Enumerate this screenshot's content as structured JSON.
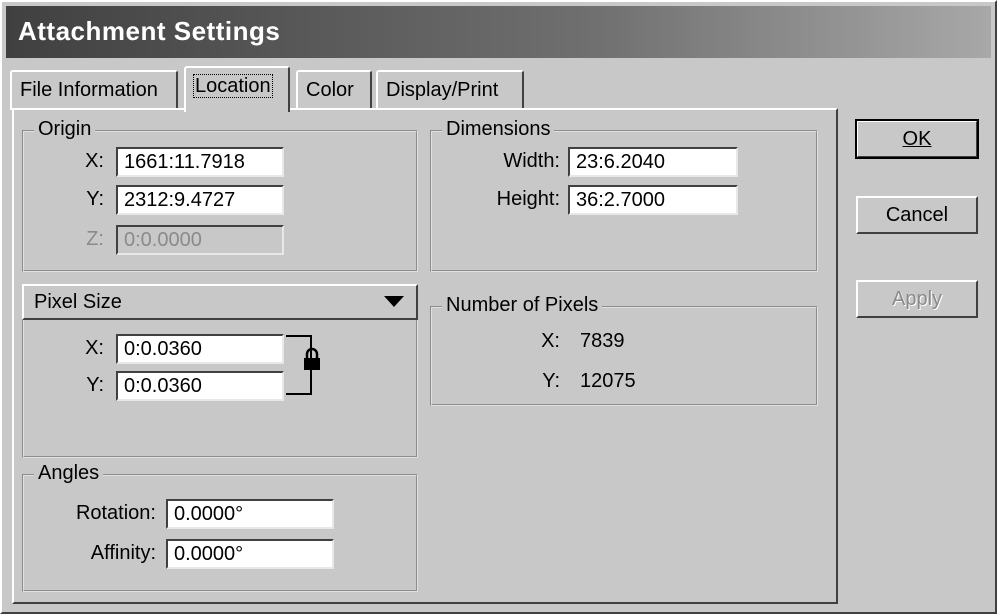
{
  "window": {
    "title": "Attachment Settings"
  },
  "tabs": [
    {
      "label": "File Information"
    },
    {
      "label": "Location"
    },
    {
      "label": "Color"
    },
    {
      "label": "Display/Print"
    }
  ],
  "origin": {
    "legend": "Origin",
    "x_label": "X:",
    "x_value": "1661:11.7918",
    "y_label": "Y:",
    "y_value": "2312:9.4727",
    "z_label": "Z:",
    "z_value": "0:0.0000"
  },
  "dimensions": {
    "legend": "Dimensions",
    "width_label": "Width:",
    "width_value": "23:6.2040",
    "height_label": "Height:",
    "height_value": "36:2.7000"
  },
  "pixel_size": {
    "selected": "Pixel Size",
    "x_label": "X:",
    "x_value": "0:0.0360",
    "y_label": "Y:",
    "y_value": "0:0.0360",
    "lock_icon": "lock-icon"
  },
  "number_of_pixels": {
    "legend": "Number of Pixels",
    "x_label": "X:",
    "x_value": "7839",
    "y_label": "Y:",
    "y_value": "12075"
  },
  "angles": {
    "legend": "Angles",
    "rotation_label": "Rotation:",
    "rotation_value": "0.0000°",
    "affinity_label": "Affinity:",
    "affinity_value": "0.0000°"
  },
  "buttons": {
    "ok": "OK",
    "cancel": "Cancel",
    "apply": "Apply"
  }
}
